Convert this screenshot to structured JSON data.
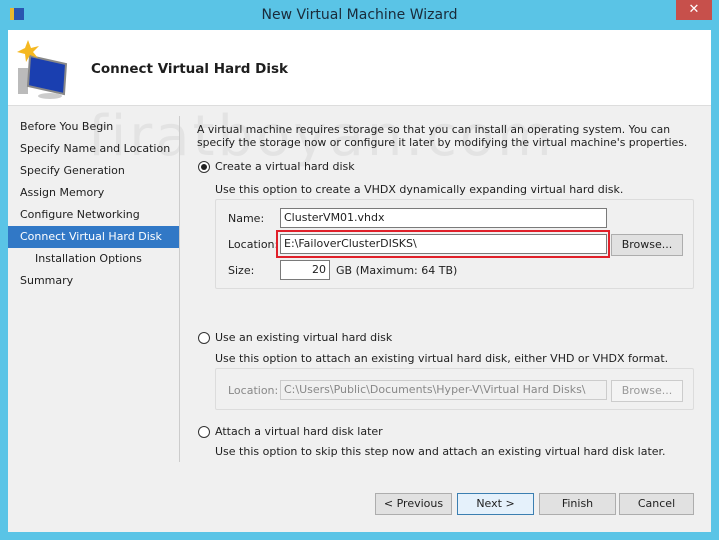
{
  "window": {
    "title": "New Virtual Machine Wizard",
    "close": "✕"
  },
  "header": {
    "title": "Connect Virtual Hard Disk",
    "watermark": "firatboyan.com"
  },
  "nav": {
    "items": [
      {
        "label": "Before You Begin"
      },
      {
        "label": "Specify Name and Location"
      },
      {
        "label": "Specify Generation"
      },
      {
        "label": "Assign Memory"
      },
      {
        "label": "Configure Networking"
      },
      {
        "label": "Connect Virtual Hard Disk",
        "selected": true
      },
      {
        "label": "Installation Options",
        "sub": true
      },
      {
        "label": "Summary"
      }
    ]
  },
  "main": {
    "intro": "A virtual machine requires storage so that you can install an operating system. You can specify the storage now or configure it later by modifying the virtual machine's properties.",
    "option_create": {
      "label": "Create a virtual hard disk",
      "selected": true,
      "desc": "Use this option to create a VHDX dynamically expanding virtual hard disk.",
      "name_label": "Name:",
      "name_value": "ClusterVM01.vhdx",
      "location_label": "Location:",
      "location_value": "E:\\FailoverClusterDISKS\\",
      "browse": "Browse...",
      "size_label": "Size:",
      "size_value": "20",
      "size_unit": "GB (Maximum: 64 TB)"
    },
    "option_existing": {
      "label": "Use an existing virtual hard disk",
      "selected": false,
      "desc": "Use this option to attach an existing virtual hard disk, either VHD or VHDX format.",
      "location_label": "Location:",
      "location_value": "C:\\Users\\Public\\Documents\\Hyper-V\\Virtual Hard Disks\\",
      "browse": "Browse..."
    },
    "option_later": {
      "label": "Attach a virtual hard disk later",
      "selected": false,
      "desc": "Use this option to skip this step now and attach an existing virtual hard disk later."
    }
  },
  "buttons": {
    "previous": "< Previous",
    "next": "Next >",
    "finish": "Finish",
    "cancel": "Cancel"
  },
  "colors": {
    "title_bar": "#5ac4e6",
    "selection": "#3178c6",
    "highlight": "#e0202a"
  }
}
